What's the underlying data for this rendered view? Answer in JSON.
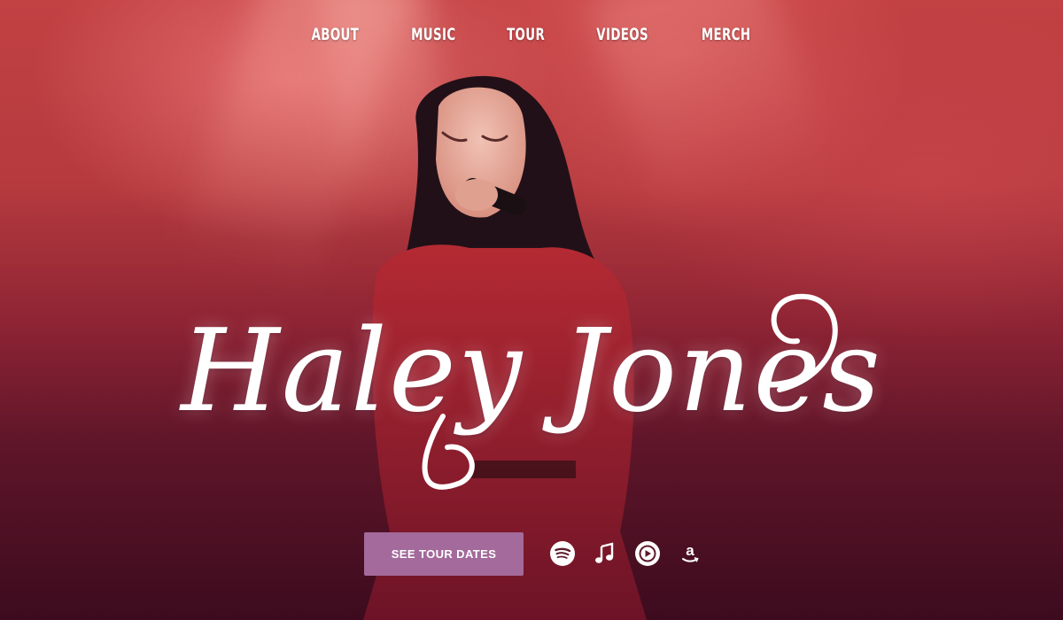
{
  "nav": {
    "items": [
      {
        "label": "ABOUT"
      },
      {
        "label": "MUSIC"
      },
      {
        "label": "TOUR"
      },
      {
        "label": "VIDEOS"
      },
      {
        "label": "MERCH"
      }
    ]
  },
  "hero": {
    "artist_name": "Haley Jones",
    "cta_label": "SEE TOUR DATES",
    "streaming_icons": [
      "spotify-icon",
      "apple-music-icon",
      "youtube-music-icon",
      "amazon-music-icon"
    ]
  },
  "colors": {
    "cta_background": "#a36a9b",
    "text": "#ffffff",
    "accent_red": "#b53a3e",
    "deep_maroon": "#3d0b1e"
  }
}
